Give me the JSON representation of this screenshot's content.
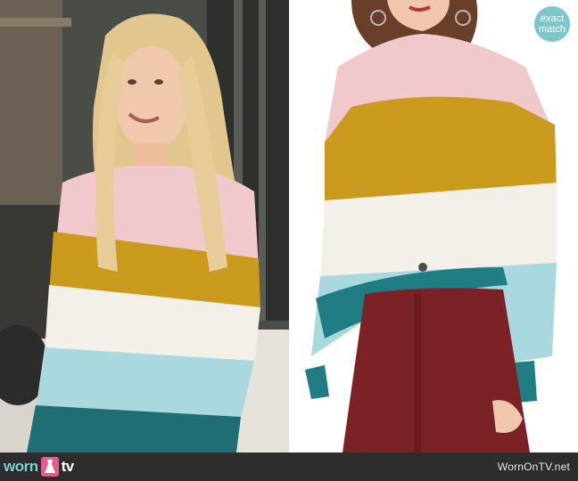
{
  "badge": {
    "line1": "exact",
    "line2": "match"
  },
  "footer": {
    "logo_part1": "worn",
    "logo_part2": "tv",
    "site": "WornOnTV.net"
  },
  "colors": {
    "pink": "#f1c9cc",
    "mustard": "#c99a1c",
    "cream": "#f3f0e9",
    "light_blue": "#a9d8de",
    "teal": "#1f7d83",
    "burgundy": "#7a2226",
    "badge": "#7dc7c9",
    "footer_bg": "#2d2d2d"
  },
  "icons": [
    "dress-icon"
  ]
}
